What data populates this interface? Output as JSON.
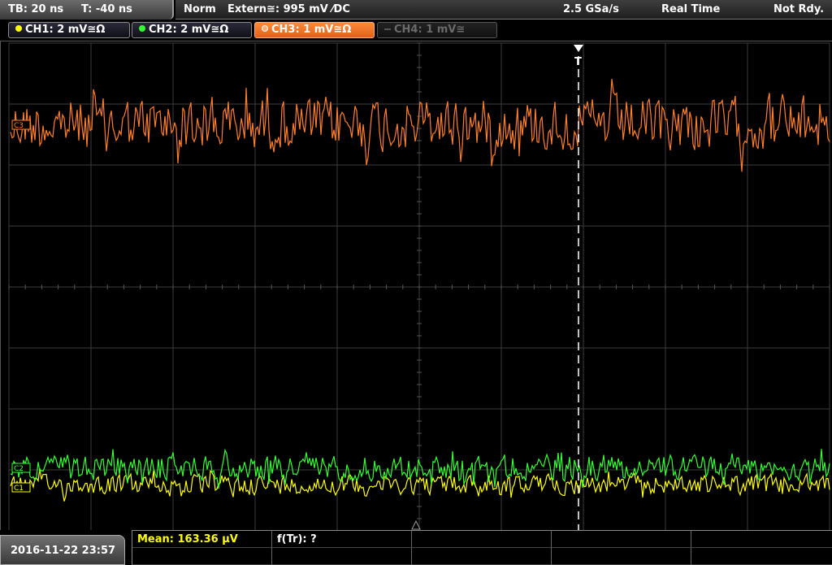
{
  "status_bar": {
    "timebase": "TB: 20 ns",
    "trigger_time": "T: -40 ns",
    "acq_mode": "Norm",
    "trigger_source": "Extern≅: 995 mV ⁄DC",
    "sample_rate": "2.5 GSa/s",
    "acq_type": "Real Time",
    "state": "Not Rdy."
  },
  "channels": [
    {
      "label": "CH1: 2 mV≅Ω",
      "color": "#ffff00",
      "state": "on"
    },
    {
      "label": "CH2: 2 mV≅Ω",
      "color": "#33ff33",
      "state": "on"
    },
    {
      "label": "CH3: 1 mV≅Ω",
      "color": "#ff7f2a",
      "state": "selected"
    },
    {
      "label": "CH4: 1 mV≅",
      "color": "#666666",
      "state": "off"
    }
  ],
  "markers": {
    "ch3": "C3",
    "ch2": "C2",
    "ch1": "C1",
    "trigger": "T"
  },
  "measurements": {
    "mean": "Mean: 163.36 µV",
    "freq": "f(Tr): ?"
  },
  "datetime": "2016-11-22 23:57",
  "colors": {
    "ch1": "#ffff00",
    "ch2": "#33ff33",
    "ch3": "#ff7f2a",
    "grid": "#3c3c3c"
  }
}
